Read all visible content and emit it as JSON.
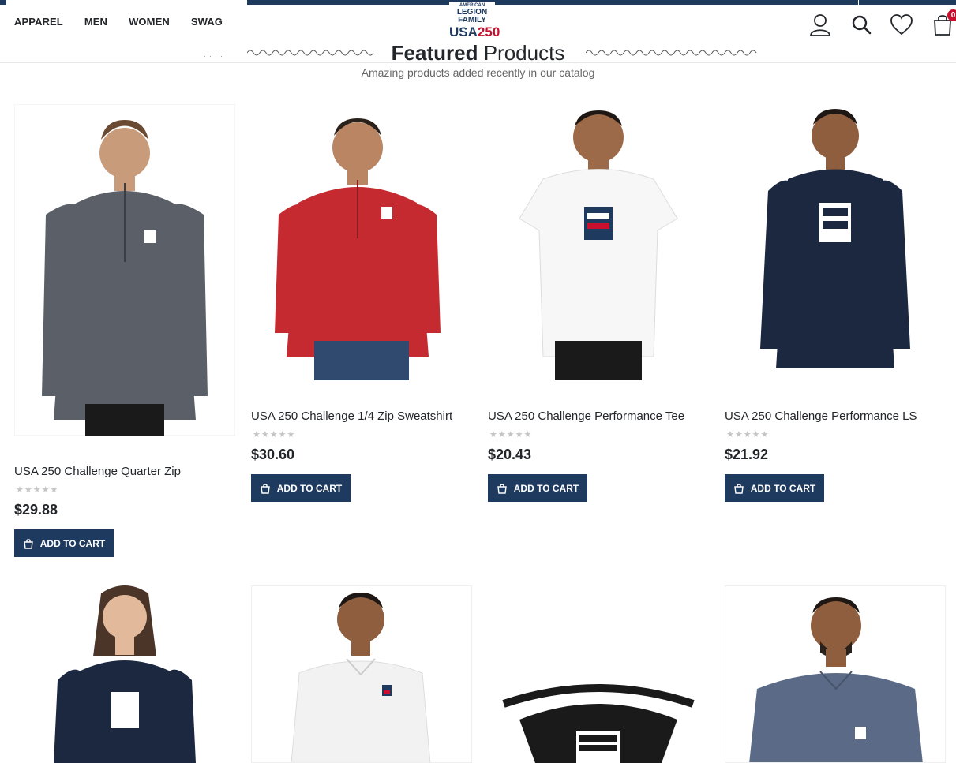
{
  "nav": {
    "items": [
      "APPAREL",
      "MEN",
      "WOMEN",
      "SWAG"
    ]
  },
  "logo": {
    "line1": "AMERICAN",
    "line2": "LEGION",
    "line3": "FAMILY",
    "usa": "USA",
    "num": "250"
  },
  "header_icons": [
    "user-icon",
    "search-icon",
    "heart-icon",
    "cart-icon"
  ],
  "cart": {
    "count": "0"
  },
  "section": {
    "title_bold": "Featured",
    "title_light": "Products",
    "subtitle": "Amazing products added recently in our catalog"
  },
  "products": [
    {
      "name": "USA 250 Challenge Quarter Zip",
      "price": "$29.88",
      "rating": "0",
      "add_label": "ADD TO CART",
      "shirt_color": "#4a4f57",
      "kind": "quarter-zip"
    },
    {
      "name": "USA 250 Challenge 1/4 Zip Sweatshirt",
      "price": "$30.60",
      "rating": "0",
      "add_label": "ADD TO CART",
      "shirt_color": "#c42a2f",
      "kind": "quarter-zip"
    },
    {
      "name": "USA 250 Challenge Performance Tee",
      "price": "$20.43",
      "rating": "0",
      "add_label": "ADD TO CART",
      "shirt_color": "#ffffff",
      "kind": "tee"
    },
    {
      "name": "USA 250 Challenge Performance LS",
      "price": "$21.92",
      "rating": "0",
      "add_label": "ADD TO CART",
      "shirt_color": "#1c2740",
      "kind": "long-sleeve"
    },
    {
      "shirt_color": "#1c2740",
      "kind": "womens-long-sleeve"
    },
    {
      "shirt_color": "#f2f2f2",
      "kind": "polo"
    },
    {
      "shirt_color": "#1a1a1a",
      "kind": "waist-bag"
    },
    {
      "shirt_color": "#5b6a86",
      "kind": "polo"
    }
  ],
  "colors": {
    "brand": "#1f3a5f",
    "accent": "#c8102e"
  }
}
